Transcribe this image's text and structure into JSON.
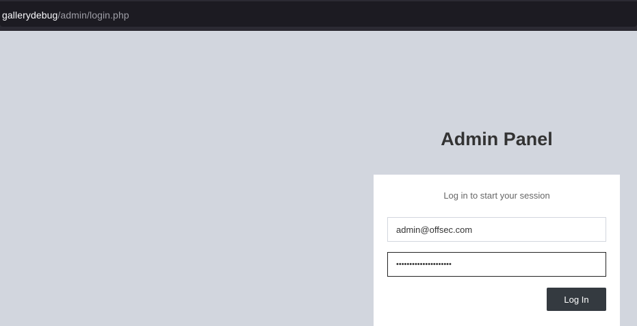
{
  "browser": {
    "url_host": "gallerydebug",
    "url_path": "/admin/login.php"
  },
  "page": {
    "title": "Admin Panel"
  },
  "login": {
    "message": "Log in to start your session",
    "email_value": "admin@offsec.com",
    "password_value": "•••••••••••••••••••••",
    "submit_label": "Log In"
  },
  "colors": {
    "page_background": "#d2d6de",
    "button_background": "#343a40",
    "browser_chrome": "#1c1b22"
  }
}
